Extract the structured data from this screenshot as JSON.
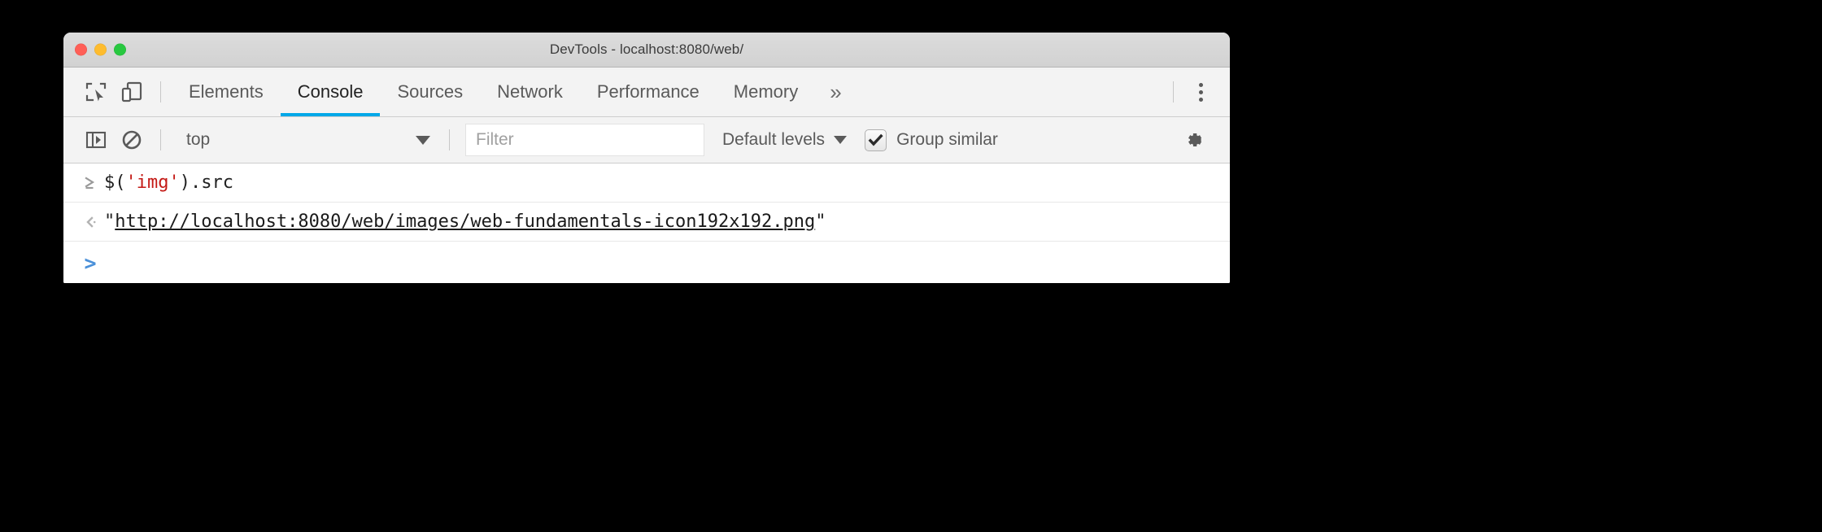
{
  "window": {
    "title": "DevTools - localhost:8080/web/",
    "traffic_lights": [
      "close",
      "minimize",
      "maximize"
    ]
  },
  "tabbar": {
    "inspect_icon": "inspect-element-icon",
    "device_icon": "device-toolbar-icon",
    "tabs": [
      {
        "label": "Elements",
        "active": false
      },
      {
        "label": "Console",
        "active": true
      },
      {
        "label": "Sources",
        "active": false
      },
      {
        "label": "Network",
        "active": false
      },
      {
        "label": "Performance",
        "active": false
      },
      {
        "label": "Memory",
        "active": false
      }
    ],
    "overflow_label": "»",
    "more_icon": "kebab-menu-icon",
    "active_underline_color": "#00a8e8"
  },
  "console_toolbar": {
    "sidebar_toggle_icon": "console-sidebar-toggle-icon",
    "clear_icon": "clear-console-icon",
    "context": {
      "value": "top",
      "caret": "chevron-down-icon"
    },
    "filter": {
      "value": "",
      "placeholder": "Filter"
    },
    "levels": {
      "label": "Default levels",
      "caret": "chevron-down-icon"
    },
    "group_similar": {
      "label": "Group similar",
      "checked": true
    },
    "settings_icon": "gear-icon"
  },
  "console": {
    "rows": [
      {
        "type": "input",
        "gutter": "⌫",
        "prefix": "$(",
        "string": "'img'",
        "suffix": ").src"
      },
      {
        "type": "output",
        "gutter": "‹",
        "quote_open": "\"",
        "url": "http://localhost:8080/web/images/web-fundamentals-icon192x192.png",
        "quote_close": "\""
      }
    ],
    "prompt": {
      "symbol": ">",
      "value": ""
    }
  },
  "colors": {
    "accent": "#00a8e8",
    "prompt": "#4a90d9",
    "string_literal": "#c41a16",
    "title_bar": "#d5d5d5",
    "toolbar_bg": "#f3f3f3"
  }
}
